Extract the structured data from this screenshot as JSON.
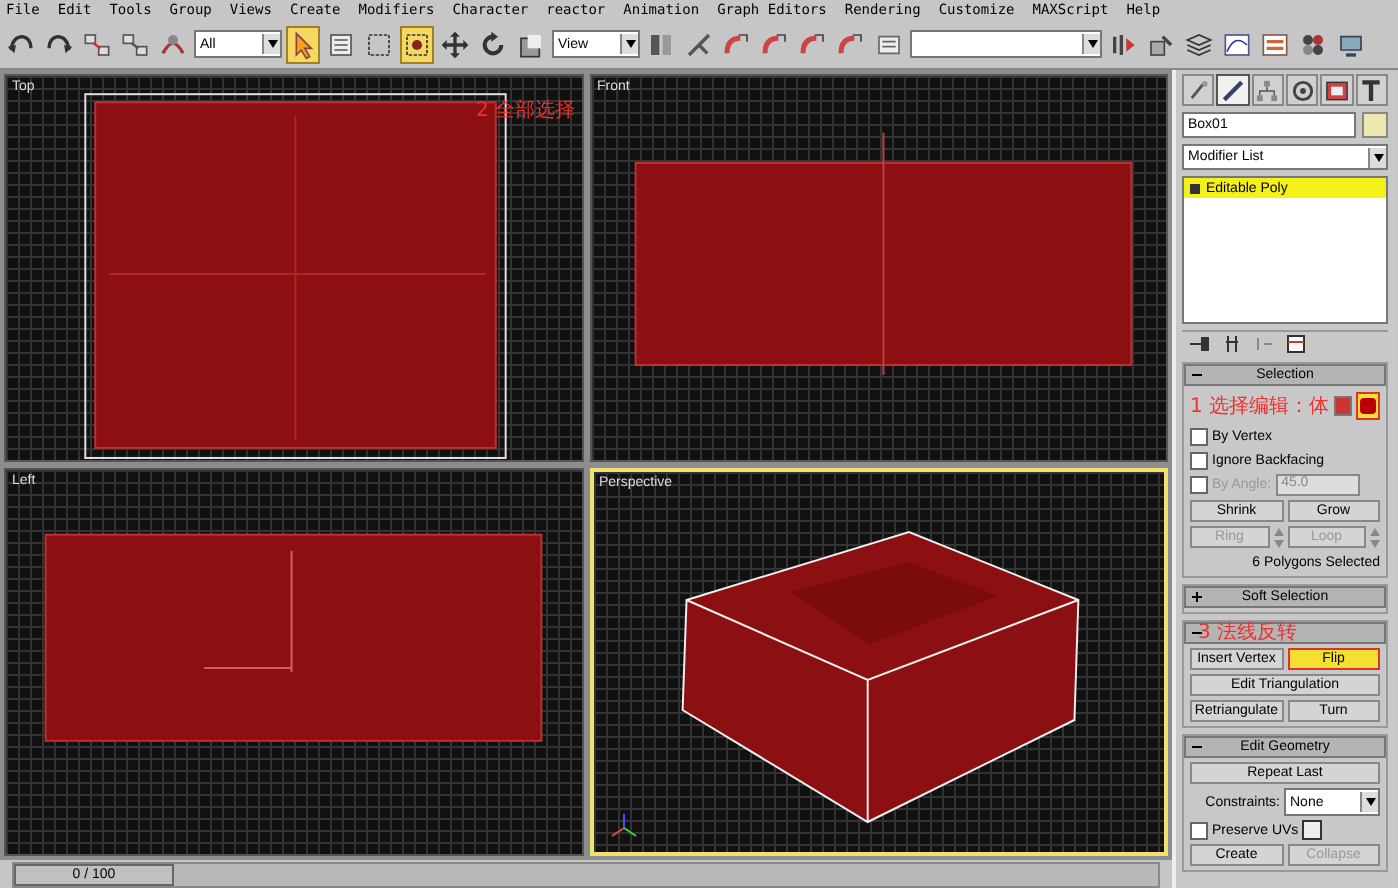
{
  "menu": [
    "File",
    "Edit",
    "Tools",
    "Group",
    "Views",
    "Create",
    "Modifiers",
    "Character",
    "reactor",
    "Animation",
    "Graph Editors",
    "Rendering",
    "Customize",
    "MAXScript",
    "Help"
  ],
  "toolbar": [
    {
      "kind": "undo",
      "selected": false
    },
    {
      "kind": "redo",
      "selected": false
    },
    {
      "kind": "link",
      "selected": false
    },
    {
      "kind": "unlink",
      "selected": false
    },
    {
      "kind": "bind",
      "selected": false
    },
    {
      "kind": "dropdown",
      "value": "All"
    },
    {
      "kind": "select",
      "selected": true
    },
    {
      "kind": "list",
      "selected": false
    },
    {
      "kind": "region",
      "selected": false
    },
    {
      "kind": "window",
      "selected": true
    },
    {
      "kind": "move",
      "selected": false
    },
    {
      "kind": "rotate",
      "selected": false
    },
    {
      "kind": "scale",
      "selected": false
    },
    {
      "kind": "dropdown",
      "value": "View"
    },
    {
      "kind": "pivot",
      "selected": false
    },
    {
      "kind": "manipulate",
      "selected": false
    },
    {
      "kind": "snap",
      "selected": false
    },
    {
      "kind": "angle-snap",
      "selected": false
    },
    {
      "kind": "percent-snap",
      "selected": false
    },
    {
      "kind": "spinner-snap",
      "selected": false
    },
    {
      "kind": "named-sets",
      "selected": false
    },
    {
      "kind": "dropdown"
    },
    {
      "kind": "mirror",
      "selected": false
    },
    {
      "kind": "align",
      "selected": false
    },
    {
      "kind": "layers",
      "selected": false
    },
    {
      "kind": "curve",
      "selected": false
    },
    {
      "kind": "schematic",
      "selected": false
    },
    {
      "kind": "material",
      "selected": false
    },
    {
      "kind": "render",
      "selected": false
    }
  ],
  "viewports": [
    {
      "label": "Top",
      "kind": "top",
      "active": false,
      "annotation": "2 全部选择"
    },
    {
      "label": "Front",
      "kind": "front",
      "active": false
    },
    {
      "label": "Left",
      "kind": "left",
      "active": false
    },
    {
      "label": "Perspective",
      "kind": "perspective",
      "active": true
    }
  ],
  "time_slider": {
    "label": "0 / 100",
    "level": 0
  },
  "command_tabs": [
    {
      "kind": "create",
      "selected": false
    },
    {
      "kind": "modify",
      "selected": true
    },
    {
      "kind": "hierarchy",
      "selected": false
    },
    {
      "kind": "motion",
      "selected": false
    },
    {
      "kind": "display",
      "selected": false
    },
    {
      "kind": "utilities",
      "selected": false
    }
  ],
  "object_name": "Box01",
  "modifier_list": "Modifier List",
  "stack": [
    {
      "label": "Editable Poly",
      "selected": true
    }
  ],
  "rollouts": [
    {
      "title": "Selection",
      "expanded": true,
      "rows": [
        {
          "kind": "subobjects",
          "annotation": "1 选择编辑：体",
          "items": [
            {
              "selected": false
            },
            {
              "selected": true
            }
          ]
        },
        {
          "kind": "checkbox",
          "label": "By Vertex",
          "checked": false,
          "disabled": false
        },
        {
          "kind": "checkbox",
          "label": "Ignore Backfacing",
          "checked": false,
          "disabled": false
        },
        {
          "kind": "spinner-check",
          "label": "By Angle:",
          "value": "45.0",
          "checked": false,
          "disabled": true
        },
        {
          "kind": "buttons",
          "buttons": [
            {
              "label": "Shrink",
              "disabled": false,
              "selected": false
            },
            {
              "label": "Grow",
              "disabled": false,
              "selected": false
            }
          ]
        },
        {
          "kind": "spinner-buttons",
          "buttons": [
            {
              "label": "Ring",
              "disabled": true,
              "selected": false
            },
            {
              "label": "Loop",
              "disabled": true,
              "selected": false
            }
          ]
        },
        {
          "kind": "text",
          "text": "6 Polygons Selected"
        }
      ]
    },
    {
      "title": "Soft Selection",
      "expanded": false
    },
    {
      "annotation": "3 法线反转",
      "expanded": true,
      "rows": [
        {
          "kind": "buttons",
          "buttons": [
            {
              "label": "Insert Vertex",
              "disabled": false,
              "selected": false
            },
            {
              "label": "Flip",
              "disabled": false,
              "selected": true
            }
          ]
        },
        {
          "kind": "buttons",
          "buttons": [
            {
              "label": "Edit Triangulation",
              "disabled": false,
              "selected": false
            }
          ]
        },
        {
          "kind": "buttons",
          "buttons": [
            {
              "label": "Retriangulate",
              "disabled": false,
              "selected": false
            },
            {
              "label": "Turn",
              "disabled": false,
              "selected": false
            }
          ]
        }
      ]
    },
    {
      "title": "Edit Geometry",
      "expanded": true,
      "rows": [
        {
          "kind": "buttons",
          "buttons": [
            {
              "label": "Repeat Last",
              "disabled": false,
              "selected": false
            }
          ]
        },
        {
          "kind": "dropdown",
          "label": "Constraints:",
          "value": "None"
        },
        {
          "kind": "checkbox-settings",
          "label": "Preserve UVs",
          "checked": false,
          "disabled": false
        },
        {
          "kind": "buttons",
          "buttons": [
            {
              "label": "Create",
              "disabled": false,
              "selected": false
            },
            {
              "label": "Collapse",
              "disabled": true,
              "selected": false
            }
          ]
        }
      ]
    }
  ]
}
